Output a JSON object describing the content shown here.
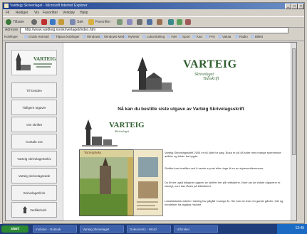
{
  "window": {
    "title": "Valdtejg Skriverlaget - Microsoft Internet Explorer",
    "controls": [
      "_",
      "□",
      "×"
    ]
  },
  "menu": [
    "Fil",
    "Rediger",
    "Vis",
    "Favoritter",
    "Verktøy",
    "Hjelp"
  ],
  "toolbar": {
    "back_label": "Tilbake",
    "search_label": "Søk",
    "favorites_label": "Favoritter"
  },
  "address": {
    "label": "Adresse",
    "url": "http://www.vardteig.no/skriverlaget/index.htm"
  },
  "links": [
    "Koblinger",
    "Gratis Hotmail",
    "Tilpass koblinger",
    "Windows",
    "Windows Media",
    "Nyheter",
    "Lokal tidning",
    "Vær",
    "Sport",
    "Kart",
    "Pris",
    "Valuta",
    "Radio",
    "Billett"
  ],
  "sidebar": {
    "logo_alt": "Skriverlaget",
    "items": [
      {
        "label": "Til forsiden"
      },
      {
        "label": "Tidligere utgaver"
      },
      {
        "label": "Om skriftet"
      },
      {
        "label": "Kontakt oss"
      },
      {
        "label": "Varteig skrivelaget/arkiv"
      },
      {
        "label": "Varteig skrivelagsrøde"
      },
      {
        "label": "Skrivelaget/info"
      },
      {
        "label": "Vedlikehold"
      }
    ]
  },
  "header": {
    "brand_line1": "VARTEIG",
    "brand_line2": "Skrivelaget",
    "brand_line3": "Tidsskrift"
  },
  "main": {
    "heading": "Nå kan du bestille siste utgave av Varteig Skrivelagsskrift",
    "sub_brand_line1": "VARTEIG",
    "sub_brand_line2": "Skrivelaget",
    "cover_title": "Varteigboka",
    "paragraphs": [
      "Varteig Skrivelagsskrift 2004 er nå klart for salg. Boka er på 48 sider med mange spennende artikler og bilder fra bygda.",
      "Skriftet kan bestilles ved å sende e-post eller ringe til en av styremedlemmene.",
      "Du finner også tidligere utgaver av skriftet her på nettsidene. Noen av de eldste utgavene er utsolgt, men kan lånes på biblioteket.",
      "Lokalhistorisk arbeid i Varteig har pågått i mange år. Her kan du lese om gamle gårder, folk og hendelser fra bygdas historie."
    ]
  },
  "taskbar": {
    "start_label": "start",
    "tasks": [
      "Innboks - Outlook",
      "Varteig Skrivelaget",
      "Dokument1 - Word",
      "Utforsker"
    ],
    "clock": "12:45"
  },
  "colors": {
    "brand_green": "#2f5e2f",
    "titlebar": "#1c3f8f",
    "taskbar": "#1f3d7a"
  }
}
